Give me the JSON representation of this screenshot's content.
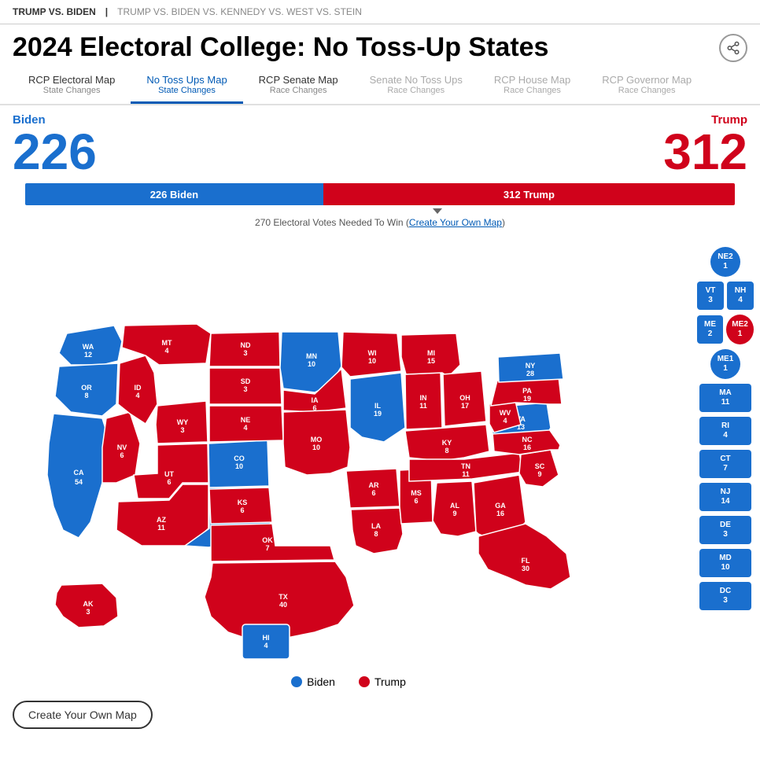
{
  "topnav": {
    "link1": "TRUMP VS. BIDEN",
    "sep": "|",
    "link2": "TRUMP VS. BIDEN VS. KENNEDY VS. WEST VS. STEIN"
  },
  "title": "2024 Electoral College: No Toss-Up States",
  "share_icon": "share",
  "tabs": [
    {
      "id": "rcp-electoral",
      "label": "RCP Electoral Map",
      "sub": "State Changes",
      "active": false,
      "disabled": false
    },
    {
      "id": "no-tossups",
      "label": "No Toss Ups Map",
      "sub": "State Changes",
      "active": true,
      "disabled": false
    },
    {
      "id": "rcp-senate",
      "label": "RCP Senate Map",
      "sub": "Race Changes",
      "active": false,
      "disabled": false
    },
    {
      "id": "senate-notossups",
      "label": "Senate No Toss Ups",
      "sub": "Race Changes",
      "active": false,
      "disabled": true
    },
    {
      "id": "rcp-house",
      "label": "RCP House Map",
      "sub": "Race Changes",
      "active": false,
      "disabled": true
    },
    {
      "id": "rcp-governor",
      "label": "RCP Governor Map",
      "sub": "Race Changes",
      "active": false,
      "disabled": true
    }
  ],
  "biden": {
    "name": "Biden",
    "score": "226",
    "bar_label": "226 Biden",
    "bar_pct": 42
  },
  "trump": {
    "name": "Trump",
    "score": "312",
    "bar_label": "312 Trump"
  },
  "bar_note": "270 Electoral Votes Needed To Win",
  "create_map_link": "Create Your Own Map",
  "legend": {
    "biden_label": "Biden",
    "trump_label": "Trump"
  },
  "create_btn_label": "Create Your Own Map",
  "right_panel_states": [
    {
      "abbr": "NE2",
      "ev": "1",
      "color": "blue",
      "circle": true
    },
    {
      "abbr": "VT",
      "ev": "3",
      "color": "blue",
      "circle": false
    },
    {
      "abbr": "NH",
      "ev": "4",
      "color": "blue",
      "circle": false
    },
    {
      "abbr": "ME2",
      "ev": "1",
      "color": "red",
      "circle": true
    },
    {
      "abbr": "ME",
      "ev": "2",
      "color": "blue",
      "circle": false
    },
    {
      "abbr": "ME1",
      "ev": "1",
      "color": "blue",
      "circle": true
    },
    {
      "abbr": "MA",
      "ev": "11",
      "color": "blue",
      "circle": false
    },
    {
      "abbr": "RI",
      "ev": "4",
      "color": "blue",
      "circle": false
    },
    {
      "abbr": "CT",
      "ev": "7",
      "color": "blue",
      "circle": false
    },
    {
      "abbr": "NJ",
      "ev": "14",
      "color": "blue",
      "circle": false
    },
    {
      "abbr": "DE",
      "ev": "3",
      "color": "blue",
      "circle": false
    },
    {
      "abbr": "MD",
      "ev": "10",
      "color": "blue",
      "circle": false
    },
    {
      "abbr": "DC",
      "ev": "3",
      "color": "blue",
      "circle": false
    }
  ]
}
